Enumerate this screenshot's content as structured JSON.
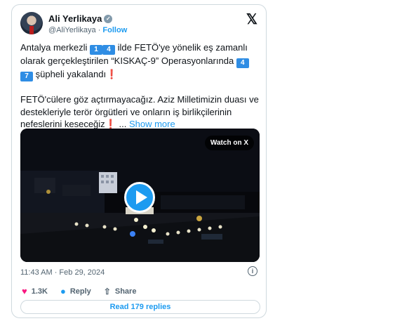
{
  "author": {
    "name": "Ali Yerlikaya",
    "handle": "@AliYerlikaya",
    "separator": "·",
    "follow_label": "Follow"
  },
  "tweet": {
    "line1_a": "Antalya merkezli ",
    "keycap_1": "1",
    "keycap_4": "4",
    "line1_b": " ilde FETÖ'ye yönelik eş zamanlı olarak gerçekleştirilen “KISKAÇ-9” Operasyonlarında ",
    "keycap_4b": "4",
    "keycap_7": "7",
    "line1_c": " şüpheli yakalandı",
    "exclamation": "❗",
    "para2": "FETÖ'cülere göz açtırmayacağız. Aziz Milletimizin duası ve destekleriyle terör örgütleri ve onların iş birlikçilerinin nefeslerini keseceğiz",
    "ellipsis": " ... ",
    "show_more": "Show more"
  },
  "video": {
    "watch_label": "Watch on X"
  },
  "meta": {
    "timestamp": "11:43 AM · Feb 29, 2024"
  },
  "actions": {
    "likes": "1.3K",
    "reply_label": "Reply",
    "share_label": "Share"
  },
  "read_replies": "Read 179 replies",
  "icons": {
    "logo": "x-logo-icon",
    "verified": "verified-badge-icon",
    "heart": "heart-icon",
    "reply": "reply-bubble-icon",
    "share": "share-icon",
    "info": "info-icon",
    "play": "play-icon"
  },
  "colors": {
    "accent": "#1d9bf0",
    "like": "#f91880",
    "keycap": "#2f8de4",
    "exclamation": "#d21f26"
  }
}
